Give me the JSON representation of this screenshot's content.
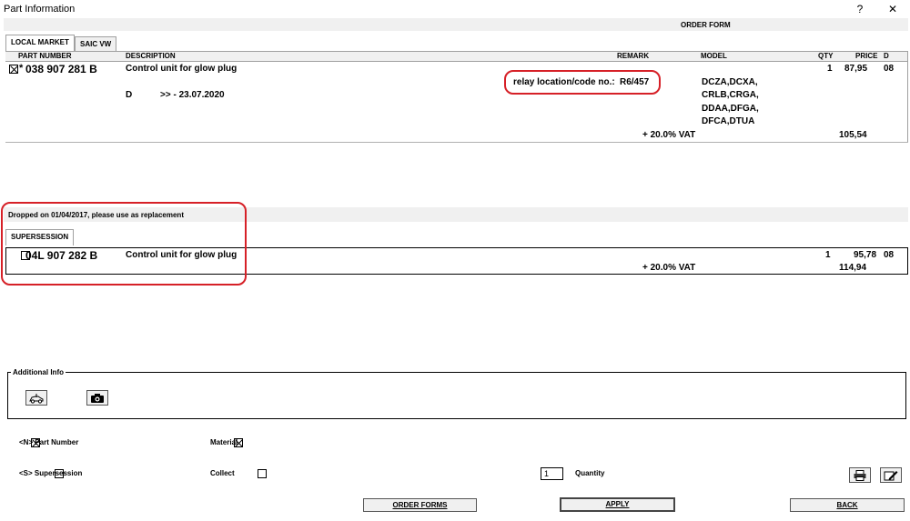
{
  "window": {
    "title": "Part Information",
    "help": "?",
    "close": "✕"
  },
  "order_form_label": "ORDER FORM",
  "tabs": [
    {
      "label": "LOCAL MARKET",
      "active": true
    },
    {
      "label": "SAIC VW",
      "active": false
    }
  ],
  "columns": {
    "part_number": "PART NUMBER",
    "description": "DESCRIPTION",
    "remark": "REMARK",
    "model": "MODEL",
    "qty": "QTY",
    "price": "PRICE",
    "d": "D"
  },
  "main_part": {
    "marker": "*",
    "part_number": "038 907 281 B",
    "description": "Control unit for glow plug",
    "remark_label": "relay location/code no.:",
    "remark_value": "R6/457",
    "sub_code": "D",
    "date_range": ">> - 23.07.2020",
    "models": [
      "DCZA,DCXA,",
      "CRLB,CRGA,",
      "DDAA,DFGA,",
      "DFCA,DTUA"
    ],
    "qty": "1",
    "price": "87,95",
    "d": "08",
    "vat_label": "+ 20.0% VAT",
    "vat_price": "105,54"
  },
  "dropped_notice": "Dropped on 01/04/2017, please use as replacement",
  "supersession_tab": "SUPERSESSION",
  "supersession_part": {
    "part_number": "04L 907 282 B",
    "description": "Control unit for glow plug",
    "qty": "1",
    "price": "95,78",
    "d": "08",
    "vat_label": "+ 20.0% VAT",
    "vat_price": "114,94"
  },
  "additional_info": {
    "legend": "Additional Info"
  },
  "options": {
    "part_number": "<N> Part Number",
    "supersession": "<S> Supersession",
    "material": "Material",
    "collect": "Collect",
    "quantity_value": "1",
    "quantity_label": "Quantity"
  },
  "buttons": {
    "order_forms": "ORDER FORMS",
    "apply": "APPLY",
    "back": "BACK"
  },
  "colors": {
    "highlight": "#d62027",
    "band": "#f0f0f0"
  }
}
